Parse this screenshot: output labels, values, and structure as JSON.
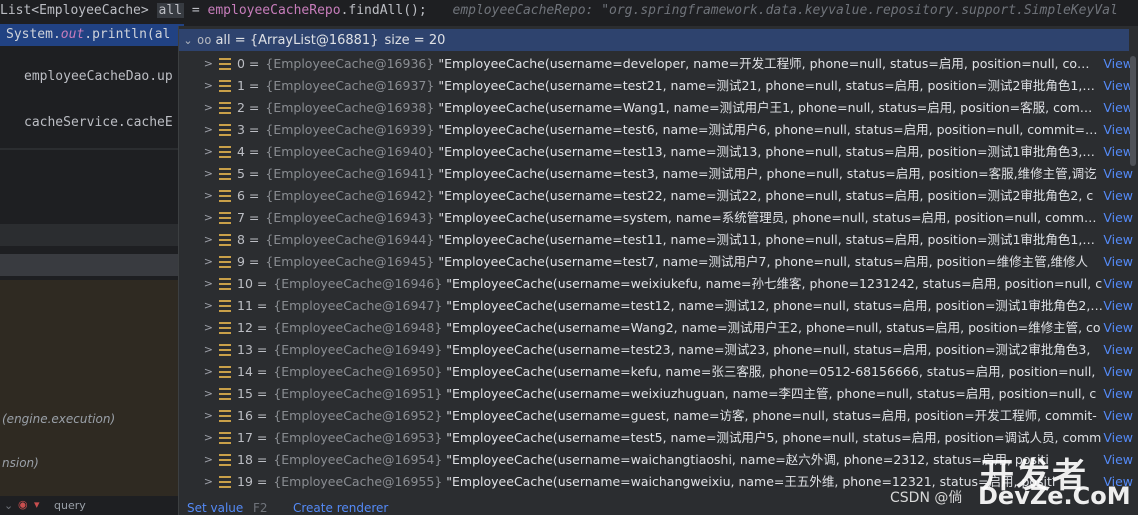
{
  "editor": {
    "line1": {
      "type": "List<EmployeeCache>",
      "var": "all",
      "op": " = ",
      "field": "employeeCacheRepo",
      "rest": ".findAll();",
      "hint": "employeeCacheRepo: \"org.springframework.data.keyvalue.repository.support.SimpleKeyVal"
    },
    "line2": {
      "prefix": "System.",
      "out": "out",
      "rest": ".println(al"
    },
    "left_lines": [
      "employeeCacheDao.up",
      "cacheService.cacheE"
    ],
    "left_italics": [
      "(engine.execution)",
      "nsion)"
    ],
    "tool_label": "query"
  },
  "popup": {
    "header": {
      "icon": "oo",
      "name": "all",
      "value": "{ArrayList@16881}",
      "size": "size = 20"
    },
    "rows": [
      {
        "idx": "0",
        "ref": "{EmployeeCache@16936}",
        "val": "\"EmployeeCache(username=developer, name=开发工程师, phone=null, status=启用, position=null, comm"
      },
      {
        "idx": "1",
        "ref": "{EmployeeCache@16937}",
        "val": "\"EmployeeCache(username=test21, name=测试21, phone=null, status=启用, position=测试2审批角色1, co"
      },
      {
        "idx": "2",
        "ref": "{EmployeeCache@16938}",
        "val": "\"EmployeeCache(username=Wang1, name=测试用户王1, phone=null, status=启用, position=客服, commit"
      },
      {
        "idx": "3",
        "ref": "{EmployeeCache@16939}",
        "val": "\"EmployeeCache(username=test6, name=测试用户6, phone=null, status=启用, position=null, commit=nu"
      },
      {
        "idx": "4",
        "ref": "{EmployeeCache@16940}",
        "val": "\"EmployeeCache(username=test13, name=测试13, phone=null, status=启用, position=测试1审批角色3, co"
      },
      {
        "idx": "5",
        "ref": "{EmployeeCache@16941}",
        "val": "\"EmployeeCache(username=test3, name=测试用户, phone=null, status=启用, position=客服,维修主管,调讫"
      },
      {
        "idx": "6",
        "ref": "{EmployeeCache@16942}",
        "val": "\"EmployeeCache(username=test22, name=测试22, phone=null, status=启用, position=测试2审批角色2, c"
      },
      {
        "idx": "7",
        "ref": "{EmployeeCache@16943}",
        "val": "\"EmployeeCache(username=system, name=系统管理员, phone=null, status=启用, position=null, commit="
      },
      {
        "idx": "8",
        "ref": "{EmployeeCache@16944}",
        "val": "\"EmployeeCache(username=test11, name=测试11, phone=null, status=启用, position=测试1审批角色1, co"
      },
      {
        "idx": "9",
        "ref": "{EmployeeCache@16945}",
        "val": "\"EmployeeCache(username=test7, name=测试用户7, phone=null, status=启用, position=维修主管,维修人"
      },
      {
        "idx": "10",
        "ref": "{EmployeeCache@16946}",
        "val": "\"EmployeeCache(username=weixiukefu, name=孙七维客, phone=1231242, status=启用, position=null, c"
      },
      {
        "idx": "11",
        "ref": "{EmployeeCache@16947}",
        "val": "\"EmployeeCache(username=test12, name=测试12, phone=null, status=启用, position=测试1审批角色2, co"
      },
      {
        "idx": "12",
        "ref": "{EmployeeCache@16948}",
        "val": "\"EmployeeCache(username=Wang2, name=测试用户王2, phone=null, status=启用, position=维修主管, co"
      },
      {
        "idx": "13",
        "ref": "{EmployeeCache@16949}",
        "val": "\"EmployeeCache(username=test23, name=测试23, phone=null, status=启用, position=测试2审批角色3,"
      },
      {
        "idx": "14",
        "ref": "{EmployeeCache@16950}",
        "val": "\"EmployeeCache(username=kefu, name=张三客服, phone=0512-68156666, status=启用, position=null,"
      },
      {
        "idx": "15",
        "ref": "{EmployeeCache@16951}",
        "val": "\"EmployeeCache(username=weixiuzhuguan, name=李四主管, phone=null, status=启用, position=null, c"
      },
      {
        "idx": "16",
        "ref": "{EmployeeCache@16952}",
        "val": "\"EmployeeCache(username=guest, name=访客, phone=null, status=启用, position=开发工程师, commit-"
      },
      {
        "idx": "17",
        "ref": "{EmployeeCache@16953}",
        "val": "\"EmployeeCache(username=test5, name=测试用户5, phone=null, status=启用, position=调试人员, comm"
      },
      {
        "idx": "18",
        "ref": "{EmployeeCache@16954}",
        "val": "\"EmployeeCache(username=waichangtiaoshi, name=赵六外调, phone=2312, status=启用, positi"
      },
      {
        "idx": "19",
        "ref": "{EmployeeCache@16955}",
        "val": "\"EmployeeCache(username=waichangweixiu, name=王五外维, phone=12321, status=启用, positi"
      }
    ],
    "view_label": "View",
    "footer": {
      "set_value": "Set value",
      "set_key": "F2",
      "create_renderer": "Create renderer"
    }
  },
  "watermark": {
    "line1": "开发者",
    "line2": "DevZe.CoM",
    "csdn": "CSDN @倘"
  }
}
